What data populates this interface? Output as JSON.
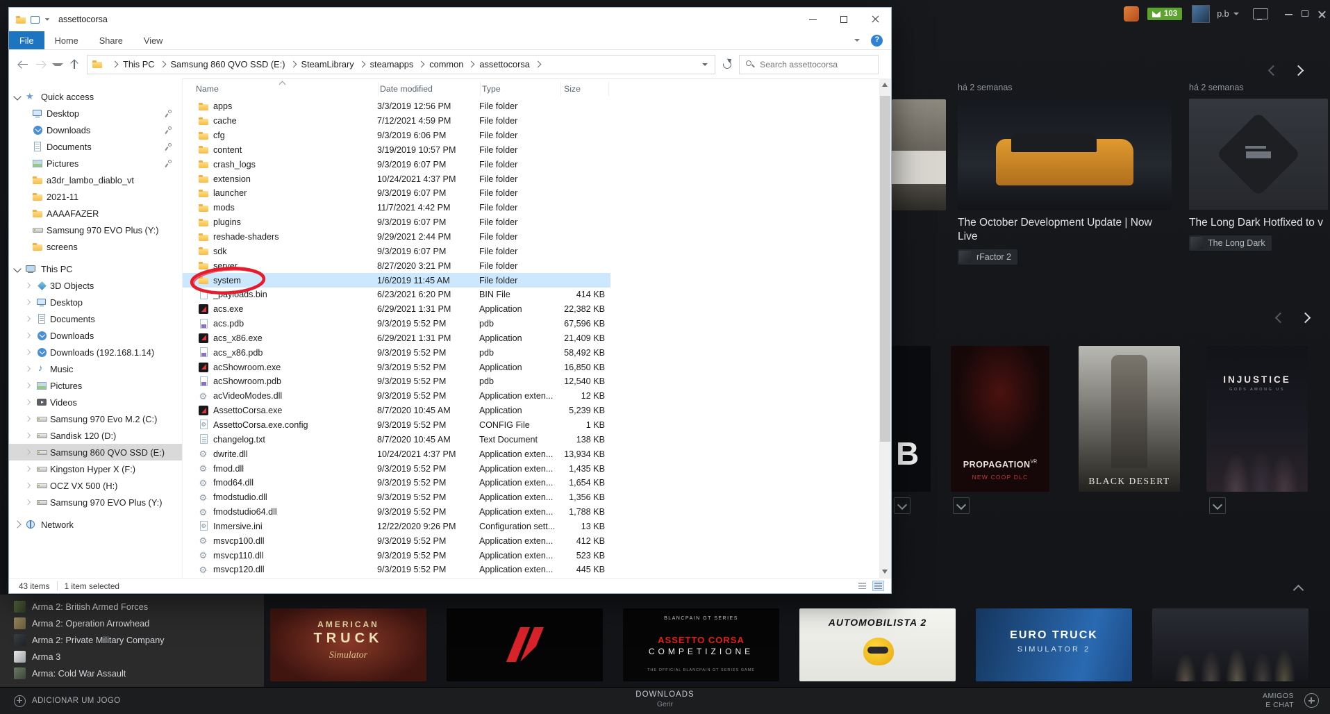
{
  "explorer": {
    "title": "assettocorsa",
    "tabs": [
      {
        "label": "File",
        "state": "active-file"
      },
      {
        "label": "Home"
      },
      {
        "label": "Share"
      },
      {
        "label": "View"
      }
    ],
    "breadcrumbs": [
      "This PC",
      "Samsung 860 QVO SSD (E:)",
      "SteamLibrary",
      "steamapps",
      "common",
      "assettocorsa"
    ],
    "search_placeholder": "Search assettocorsa",
    "columns": [
      {
        "label": "Name"
      },
      {
        "label": "Date modified"
      },
      {
        "label": "Type"
      },
      {
        "label": "Size"
      }
    ],
    "sidebar": {
      "quick_access": "Quick access",
      "quick_items": [
        {
          "label": "Desktop",
          "icon": "desktop",
          "pin": "pin"
        },
        {
          "label": "Downloads",
          "icon": "downloads",
          "pin": "pin"
        },
        {
          "label": "Documents",
          "icon": "documents",
          "pin": "pin"
        },
        {
          "label": "Pictures",
          "icon": "pictures",
          "pin": "pin"
        },
        {
          "label": "a3dr_lambo_diablo_vt",
          "icon": "folder"
        },
        {
          "label": "2021-11",
          "icon": "folder"
        },
        {
          "label": "AAAAFAZER",
          "icon": "folder"
        },
        {
          "label": "Samsung 970 EVO Plus (Y:)",
          "icon": "drive"
        },
        {
          "label": "screens",
          "icon": "folder"
        }
      ],
      "this_pc": "This PC",
      "pc_items": [
        {
          "label": "3D Objects",
          "icon": "cube"
        },
        {
          "label": "Desktop",
          "icon": "desktop"
        },
        {
          "label": "Documents",
          "icon": "documents"
        },
        {
          "label": "Downloads",
          "icon": "downloads"
        },
        {
          "label": "Downloads (192.168.1.14)",
          "icon": "downloads"
        },
        {
          "label": "Music",
          "icon": "music"
        },
        {
          "label": "Pictures",
          "icon": "pictures"
        },
        {
          "label": "Videos",
          "icon": "videos"
        },
        {
          "label": "Samsung 970 Evo M.2 (C:)",
          "icon": "drive"
        },
        {
          "label": "Sandisk 120 (D:)",
          "icon": "drive"
        },
        {
          "label": "Samsung 860 QVO SSD (E:)",
          "icon": "drive",
          "state": "current"
        },
        {
          "label": "Kingston Hyper X (F:)",
          "icon": "drive"
        },
        {
          "label": "OCZ VX 500 (H:)",
          "icon": "drive"
        },
        {
          "label": "Samsung 970 EVO Plus (Y:)",
          "icon": "drive"
        }
      ],
      "network": "Network"
    },
    "files": [
      {
        "name": "apps",
        "date": "3/3/2019 12:56 PM",
        "type": "File folder",
        "size": "",
        "icon": "folder"
      },
      {
        "name": "cache",
        "date": "7/12/2021 4:59 PM",
        "type": "File folder",
        "size": "",
        "icon": "folder"
      },
      {
        "name": "cfg",
        "date": "9/3/2019 6:06 PM",
        "type": "File folder",
        "size": "",
        "icon": "folder"
      },
      {
        "name": "content",
        "date": "3/19/2019 10:57 PM",
        "type": "File folder",
        "size": "",
        "icon": "folder"
      },
      {
        "name": "crash_logs",
        "date": "9/3/2019 6:07 PM",
        "type": "File folder",
        "size": "",
        "icon": "folder"
      },
      {
        "name": "extension",
        "date": "10/24/2021 4:37 PM",
        "type": "File folder",
        "size": "",
        "icon": "folder"
      },
      {
        "name": "launcher",
        "date": "9/3/2019 6:07 PM",
        "type": "File folder",
        "size": "",
        "icon": "folder"
      },
      {
        "name": "mods",
        "date": "11/7/2021 4:42 PM",
        "type": "File folder",
        "size": "",
        "icon": "folder"
      },
      {
        "name": "plugins",
        "date": "9/3/2019 6:07 PM",
        "type": "File folder",
        "size": "",
        "icon": "folder"
      },
      {
        "name": "reshade-shaders",
        "date": "9/29/2021 2:44 PM",
        "type": "File folder",
        "size": "",
        "icon": "folder"
      },
      {
        "name": "sdk",
        "date": "9/3/2019 6:07 PM",
        "type": "File folder",
        "size": "",
        "icon": "folder"
      },
      {
        "name": "server",
        "date": "8/27/2020 3:21 PM",
        "type": "File folder",
        "size": "",
        "icon": "folder"
      },
      {
        "name": "system",
        "date": "1/6/2019 11:45 AM",
        "type": "File folder",
        "size": "",
        "icon": "folder",
        "state": "selected"
      },
      {
        "name": "_payloads.bin",
        "date": "6/23/2021 6:20 PM",
        "type": "BIN File",
        "size": "414 KB",
        "icon": "file"
      },
      {
        "name": "acs.exe",
        "date": "6/29/2021 1:31 PM",
        "type": "Application",
        "size": "22,382 KB",
        "icon": "exe"
      },
      {
        "name": "acs.pdb",
        "date": "9/3/2019 5:52 PM",
        "type": "pdb",
        "size": "67,596 KB",
        "icon": "pdb"
      },
      {
        "name": "acs_x86.exe",
        "date": "6/29/2021 1:31 PM",
        "type": "Application",
        "size": "21,409 KB",
        "icon": "exe"
      },
      {
        "name": "acs_x86.pdb",
        "date": "9/3/2019 5:52 PM",
        "type": "pdb",
        "size": "58,492 KB",
        "icon": "pdb"
      },
      {
        "name": "acShowroom.exe",
        "date": "9/3/2019 5:52 PM",
        "type": "Application",
        "size": "16,850 KB",
        "icon": "exe"
      },
      {
        "name": "acShowroom.pdb",
        "date": "9/3/2019 5:52 PM",
        "type": "pdb",
        "size": "12,540 KB",
        "icon": "pdb"
      },
      {
        "name": "acVideoModes.dll",
        "date": "9/3/2019 5:52 PM",
        "type": "Application exten...",
        "size": "12 KB",
        "icon": "dll"
      },
      {
        "name": "AssettoCorsa.exe",
        "date": "8/7/2020 10:45 AM",
        "type": "Application",
        "size": "5,239 KB",
        "icon": "exe"
      },
      {
        "name": "AssettoCorsa.exe.config",
        "date": "9/3/2019 5:52 PM",
        "type": "CONFIG File",
        "size": "1 KB",
        "icon": "cfg"
      },
      {
        "name": "changelog.txt",
        "date": "8/7/2020 10:45 AM",
        "type": "Text Document",
        "size": "138 KB",
        "icon": "txt"
      },
      {
        "name": "dwrite.dll",
        "date": "10/24/2021 4:37 PM",
        "type": "Application exten...",
        "size": "13,934 KB",
        "icon": "dll"
      },
      {
        "name": "fmod.dll",
        "date": "9/3/2019 5:52 PM",
        "type": "Application exten...",
        "size": "1,435 KB",
        "icon": "dll"
      },
      {
        "name": "fmod64.dll",
        "date": "9/3/2019 5:52 PM",
        "type": "Application exten...",
        "size": "1,654 KB",
        "icon": "dll"
      },
      {
        "name": "fmodstudio.dll",
        "date": "9/3/2019 5:52 PM",
        "type": "Application exten...",
        "size": "1,356 KB",
        "icon": "dll"
      },
      {
        "name": "fmodstudio64.dll",
        "date": "9/3/2019 5:52 PM",
        "type": "Application exten...",
        "size": "1,788 KB",
        "icon": "dll"
      },
      {
        "name": "Inmersive.ini",
        "date": "12/22/2020 9:26 PM",
        "type": "Configuration sett...",
        "size": "13 KB",
        "icon": "cfg"
      },
      {
        "name": "msvcp100.dll",
        "date": "9/3/2019 5:52 PM",
        "type": "Application exten...",
        "size": "412 KB",
        "icon": "dll"
      },
      {
        "name": "msvcp110.dll",
        "date": "9/3/2019 5:52 PM",
        "type": "Application exten...",
        "size": "523 KB",
        "icon": "dll"
      },
      {
        "name": "msvcp120.dll",
        "date": "9/3/2019 5:52 PM",
        "type": "Application exten...",
        "size": "445 KB",
        "icon": "dll"
      }
    ],
    "status": {
      "items": "43 items",
      "selected": "1 item selected"
    }
  },
  "steam": {
    "topbar": {
      "messages": "103",
      "user": "p.b"
    },
    "news": [
      {
        "ago": "há 2 semanas",
        "title": "The October Development Update | Now Live",
        "game": "rFactor 2",
        "image": "rfactor2-car"
      },
      {
        "ago": "há 2 semanas",
        "title": "The Long Dark Hotfixed to v",
        "game": "The Long Dark",
        "image": "longdark-anvil"
      }
    ],
    "capsules": [
      {
        "id": "sliver",
        "letter": "B"
      },
      {
        "id": "propagation",
        "title": "PROPAGATION",
        "sup": "VR",
        "sub": "NEW COOP DLC"
      },
      {
        "id": "blackdesert",
        "title": "BLACK DESERT"
      },
      {
        "id": "injustice",
        "title": "INJUSTICE",
        "sub": "GODS AMONG US"
      }
    ],
    "library": [
      {
        "label": "Arma 2: British Armed Forces",
        "icon": "arma2baf"
      },
      {
        "label": "Arma 2: Operation Arrowhead",
        "icon": "arma2oa"
      },
      {
        "label": "Arma 2: Private Military Company",
        "icon": "arma2pmc"
      },
      {
        "label": "Arma 3",
        "icon": "arma3"
      },
      {
        "label": "Arma: Cold War Assault",
        "icon": "armacwa"
      }
    ],
    "banners": [
      {
        "id": "ats",
        "l1": "AMERICAN",
        "l2": "TRUCK",
        "l3": "Simulator"
      },
      {
        "id": "ac"
      },
      {
        "id": "acc",
        "l1": "BLANCPAIN GT SERIES",
        "l2": "ASSETTO CORSA",
        "l3": "COMPETIZIONE",
        "l4": "THE OFFICIAL BLANCPAIN GT SERIES GAME"
      },
      {
        "id": "ams2",
        "l1": "AUTOMOBILISTA 2"
      },
      {
        "id": "ets2",
        "l1": "EURO TRUCK",
        "l2": "SIMULATOR 2"
      },
      {
        "id": "dark"
      }
    ],
    "bottombar": {
      "add_game": "ADICIONAR UM JOGO",
      "downloads_label": "DOWNLOADS",
      "downloads_sub": "Gerir",
      "friends_l1": "AMIGOS",
      "friends_l2": "E CHAT"
    }
  }
}
